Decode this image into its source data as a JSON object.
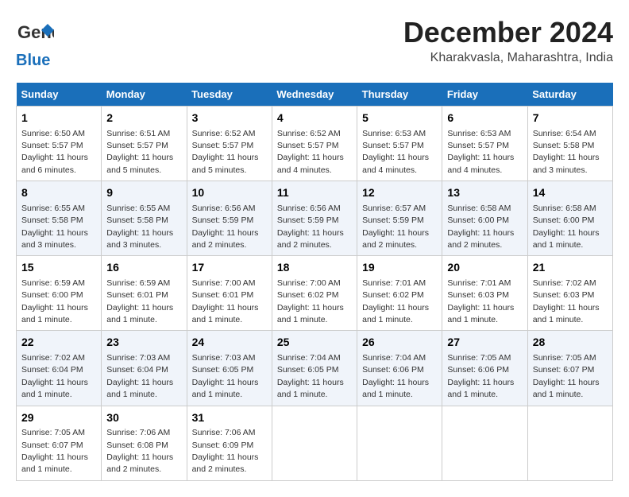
{
  "header": {
    "logo_general": "General",
    "logo_blue": "Blue",
    "title": "December 2024",
    "location": "Kharakvasla, Maharashtra, India"
  },
  "days_of_week": [
    "Sunday",
    "Monday",
    "Tuesday",
    "Wednesday",
    "Thursday",
    "Friday",
    "Saturday"
  ],
  "weeks": [
    [
      {
        "day": "1",
        "info": "Sunrise: 6:50 AM\nSunset: 5:57 PM\nDaylight: 11 hours and 6 minutes."
      },
      {
        "day": "2",
        "info": "Sunrise: 6:51 AM\nSunset: 5:57 PM\nDaylight: 11 hours and 5 minutes."
      },
      {
        "day": "3",
        "info": "Sunrise: 6:52 AM\nSunset: 5:57 PM\nDaylight: 11 hours and 5 minutes."
      },
      {
        "day": "4",
        "info": "Sunrise: 6:52 AM\nSunset: 5:57 PM\nDaylight: 11 hours and 4 minutes."
      },
      {
        "day": "5",
        "info": "Sunrise: 6:53 AM\nSunset: 5:57 PM\nDaylight: 11 hours and 4 minutes."
      },
      {
        "day": "6",
        "info": "Sunrise: 6:53 AM\nSunset: 5:57 PM\nDaylight: 11 hours and 4 minutes."
      },
      {
        "day": "7",
        "info": "Sunrise: 6:54 AM\nSunset: 5:58 PM\nDaylight: 11 hours and 3 minutes."
      }
    ],
    [
      {
        "day": "8",
        "info": "Sunrise: 6:55 AM\nSunset: 5:58 PM\nDaylight: 11 hours and 3 minutes."
      },
      {
        "day": "9",
        "info": "Sunrise: 6:55 AM\nSunset: 5:58 PM\nDaylight: 11 hours and 3 minutes."
      },
      {
        "day": "10",
        "info": "Sunrise: 6:56 AM\nSunset: 5:59 PM\nDaylight: 11 hours and 2 minutes."
      },
      {
        "day": "11",
        "info": "Sunrise: 6:56 AM\nSunset: 5:59 PM\nDaylight: 11 hours and 2 minutes."
      },
      {
        "day": "12",
        "info": "Sunrise: 6:57 AM\nSunset: 5:59 PM\nDaylight: 11 hours and 2 minutes."
      },
      {
        "day": "13",
        "info": "Sunrise: 6:58 AM\nSunset: 6:00 PM\nDaylight: 11 hours and 2 minutes."
      },
      {
        "day": "14",
        "info": "Sunrise: 6:58 AM\nSunset: 6:00 PM\nDaylight: 11 hours and 1 minute."
      }
    ],
    [
      {
        "day": "15",
        "info": "Sunrise: 6:59 AM\nSunset: 6:00 PM\nDaylight: 11 hours and 1 minute."
      },
      {
        "day": "16",
        "info": "Sunrise: 6:59 AM\nSunset: 6:01 PM\nDaylight: 11 hours and 1 minute."
      },
      {
        "day": "17",
        "info": "Sunrise: 7:00 AM\nSunset: 6:01 PM\nDaylight: 11 hours and 1 minute."
      },
      {
        "day": "18",
        "info": "Sunrise: 7:00 AM\nSunset: 6:02 PM\nDaylight: 11 hours and 1 minute."
      },
      {
        "day": "19",
        "info": "Sunrise: 7:01 AM\nSunset: 6:02 PM\nDaylight: 11 hours and 1 minute."
      },
      {
        "day": "20",
        "info": "Sunrise: 7:01 AM\nSunset: 6:03 PM\nDaylight: 11 hours and 1 minute."
      },
      {
        "day": "21",
        "info": "Sunrise: 7:02 AM\nSunset: 6:03 PM\nDaylight: 11 hours and 1 minute."
      }
    ],
    [
      {
        "day": "22",
        "info": "Sunrise: 7:02 AM\nSunset: 6:04 PM\nDaylight: 11 hours and 1 minute."
      },
      {
        "day": "23",
        "info": "Sunrise: 7:03 AM\nSunset: 6:04 PM\nDaylight: 11 hours and 1 minute."
      },
      {
        "day": "24",
        "info": "Sunrise: 7:03 AM\nSunset: 6:05 PM\nDaylight: 11 hours and 1 minute."
      },
      {
        "day": "25",
        "info": "Sunrise: 7:04 AM\nSunset: 6:05 PM\nDaylight: 11 hours and 1 minute."
      },
      {
        "day": "26",
        "info": "Sunrise: 7:04 AM\nSunset: 6:06 PM\nDaylight: 11 hours and 1 minute."
      },
      {
        "day": "27",
        "info": "Sunrise: 7:05 AM\nSunset: 6:06 PM\nDaylight: 11 hours and 1 minute."
      },
      {
        "day": "28",
        "info": "Sunrise: 7:05 AM\nSunset: 6:07 PM\nDaylight: 11 hours and 1 minute."
      }
    ],
    [
      {
        "day": "29",
        "info": "Sunrise: 7:05 AM\nSunset: 6:07 PM\nDaylight: 11 hours and 1 minute."
      },
      {
        "day": "30",
        "info": "Sunrise: 7:06 AM\nSunset: 6:08 PM\nDaylight: 11 hours and 2 minutes."
      },
      {
        "day": "31",
        "info": "Sunrise: 7:06 AM\nSunset: 6:09 PM\nDaylight: 11 hours and 2 minutes."
      },
      {
        "day": "",
        "info": ""
      },
      {
        "day": "",
        "info": ""
      },
      {
        "day": "",
        "info": ""
      },
      {
        "day": "",
        "info": ""
      }
    ]
  ]
}
